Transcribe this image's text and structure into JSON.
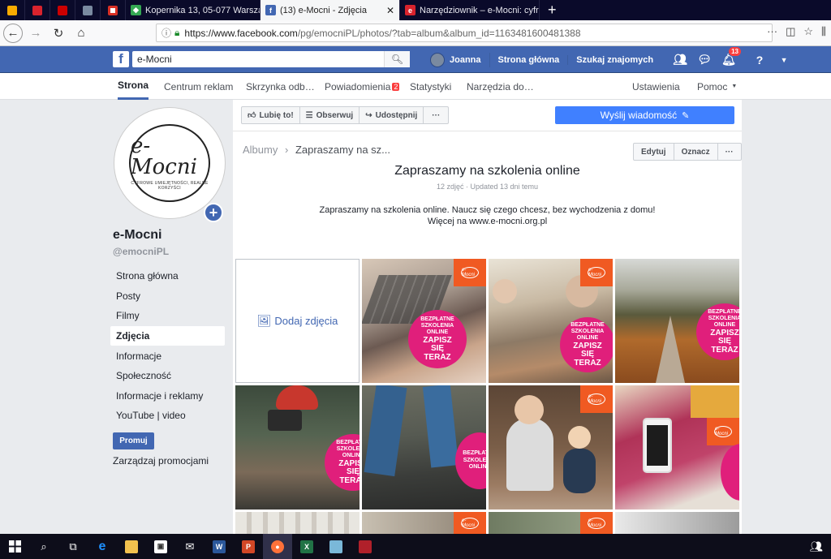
{
  "browser": {
    "tabs": [
      {
        "title": "Kopernika 13, 05-077 Warszaw",
        "fav": "maps",
        "favcolor": "#34a853"
      },
      {
        "title": "(13) e-Mocni - Zdjęcia",
        "fav": "f",
        "favcolor": "#4267b2",
        "active": true
      },
      {
        "title": "Narzędziownik – e-Mocni: cyfr",
        "fav": "e",
        "favcolor": "#d9232d"
      }
    ],
    "new_tab": "+",
    "url_host": "https://www.facebook.com",
    "url_path": "/pg/emocniPL/photos/?tab=album&album_id=1163481600481388"
  },
  "fb": {
    "search_value": "e-Mocni",
    "user": "Joanna",
    "home": "Strona główna",
    "find_friends": "Szukaj znajomych",
    "notif_count": "13"
  },
  "pagenav": {
    "items": [
      "Strona",
      "Centrum reklam",
      "Skrzynka odb…",
      "Powiadomienia",
      "Statystyki",
      "Narzędzia do…",
      "Ustawienia",
      "Pomoc"
    ],
    "notif_badge": "2"
  },
  "sidebar": {
    "logo_text": "e-Mocni",
    "logo_sub": "CYFROWE UMIEJĘTNOŚCI, REALNE KORZYŚCI",
    "name": "e-Mocni",
    "handle": "@emocniPL",
    "menu": [
      "Strona główna",
      "Posty",
      "Filmy",
      "Zdjęcia",
      "Informacje",
      "Społeczność",
      "Informacje i reklamy",
      "YouTube | video"
    ],
    "promote": "Promuj",
    "manage_promos": "Zarządzaj promocjami"
  },
  "actions": {
    "like": "Lubię to!",
    "follow": "Obserwuj",
    "share": "Udostępnij",
    "more": "···",
    "send_message": "Wyślij wiadomość"
  },
  "album": {
    "breadcrumb_root": "Albumy",
    "breadcrumb_current": "Zapraszamy na sz...",
    "edit": "Edytuj",
    "tag": "Oznacz",
    "more": "···",
    "title": "Zapraszamy na szkolenia online",
    "meta": "12 zdjęć · Updated 13 dni temu",
    "desc1": "Zapraszamy na szkolenia online. Naucz się czego chcesz, bez wychodzenia z domu!",
    "desc2": "Więcej na www.e-mocni.org.pl",
    "add_photos": "Dodaj zdjęcia",
    "promo_small": "BEZPŁATNE SZKOLENIA ONLINE",
    "promo_big": "ZAPISZ SIĘ TERAZ"
  },
  "colors": {
    "fb_blue": "#4267b2",
    "accent_pink": "#e01f7b",
    "accent_orange": "#f05a22"
  }
}
